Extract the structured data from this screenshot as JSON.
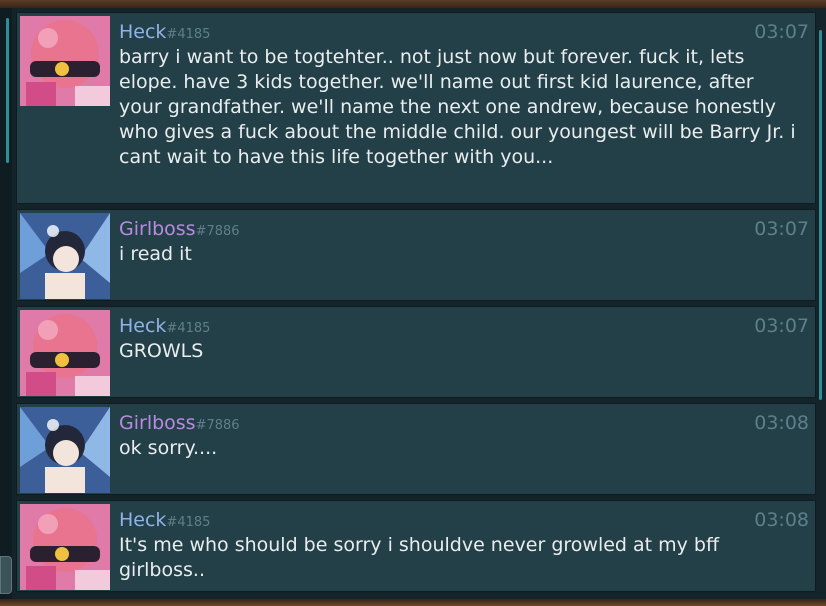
{
  "messages": [
    {
      "author": "Heck",
      "discriminator": "#4185",
      "time": "03:07",
      "avatar": "pink-octoling-avatar",
      "text": "barry i want to be togtehter.. not just now but forever. fuck it, lets elope. have 3 kids together. we'll name out first  kid laurence, after your grandfather. we'll name the next one andrew, because honestly who gives a fuck about the middle child. our youngest will be Barry Jr. i cant wait to have this life together with you..."
    },
    {
      "author": "Girlboss",
      "discriminator": "#7886",
      "time": "03:07",
      "avatar": "anime-girl-avatar",
      "text": "i read it"
    },
    {
      "author": "Heck",
      "discriminator": "#4185",
      "time": "03:07",
      "avatar": "pink-octoling-avatar",
      "text": "GROWLS"
    },
    {
      "author": "Girlboss",
      "discriminator": "#7886",
      "time": "03:08",
      "avatar": "anime-girl-avatar",
      "text": "ok sorry...."
    },
    {
      "author": "Heck",
      "discriminator": "#4185",
      "time": "03:08",
      "avatar": "pink-octoling-avatar",
      "text": "It's me who should be sorry i shouldve never growled at my bff girlboss.."
    }
  ],
  "colors": {
    "heck_name": "#8fb3e6",
    "girlboss_name": "#b98be0",
    "message_bg": "#233f48",
    "accent": "#2f8f96"
  }
}
